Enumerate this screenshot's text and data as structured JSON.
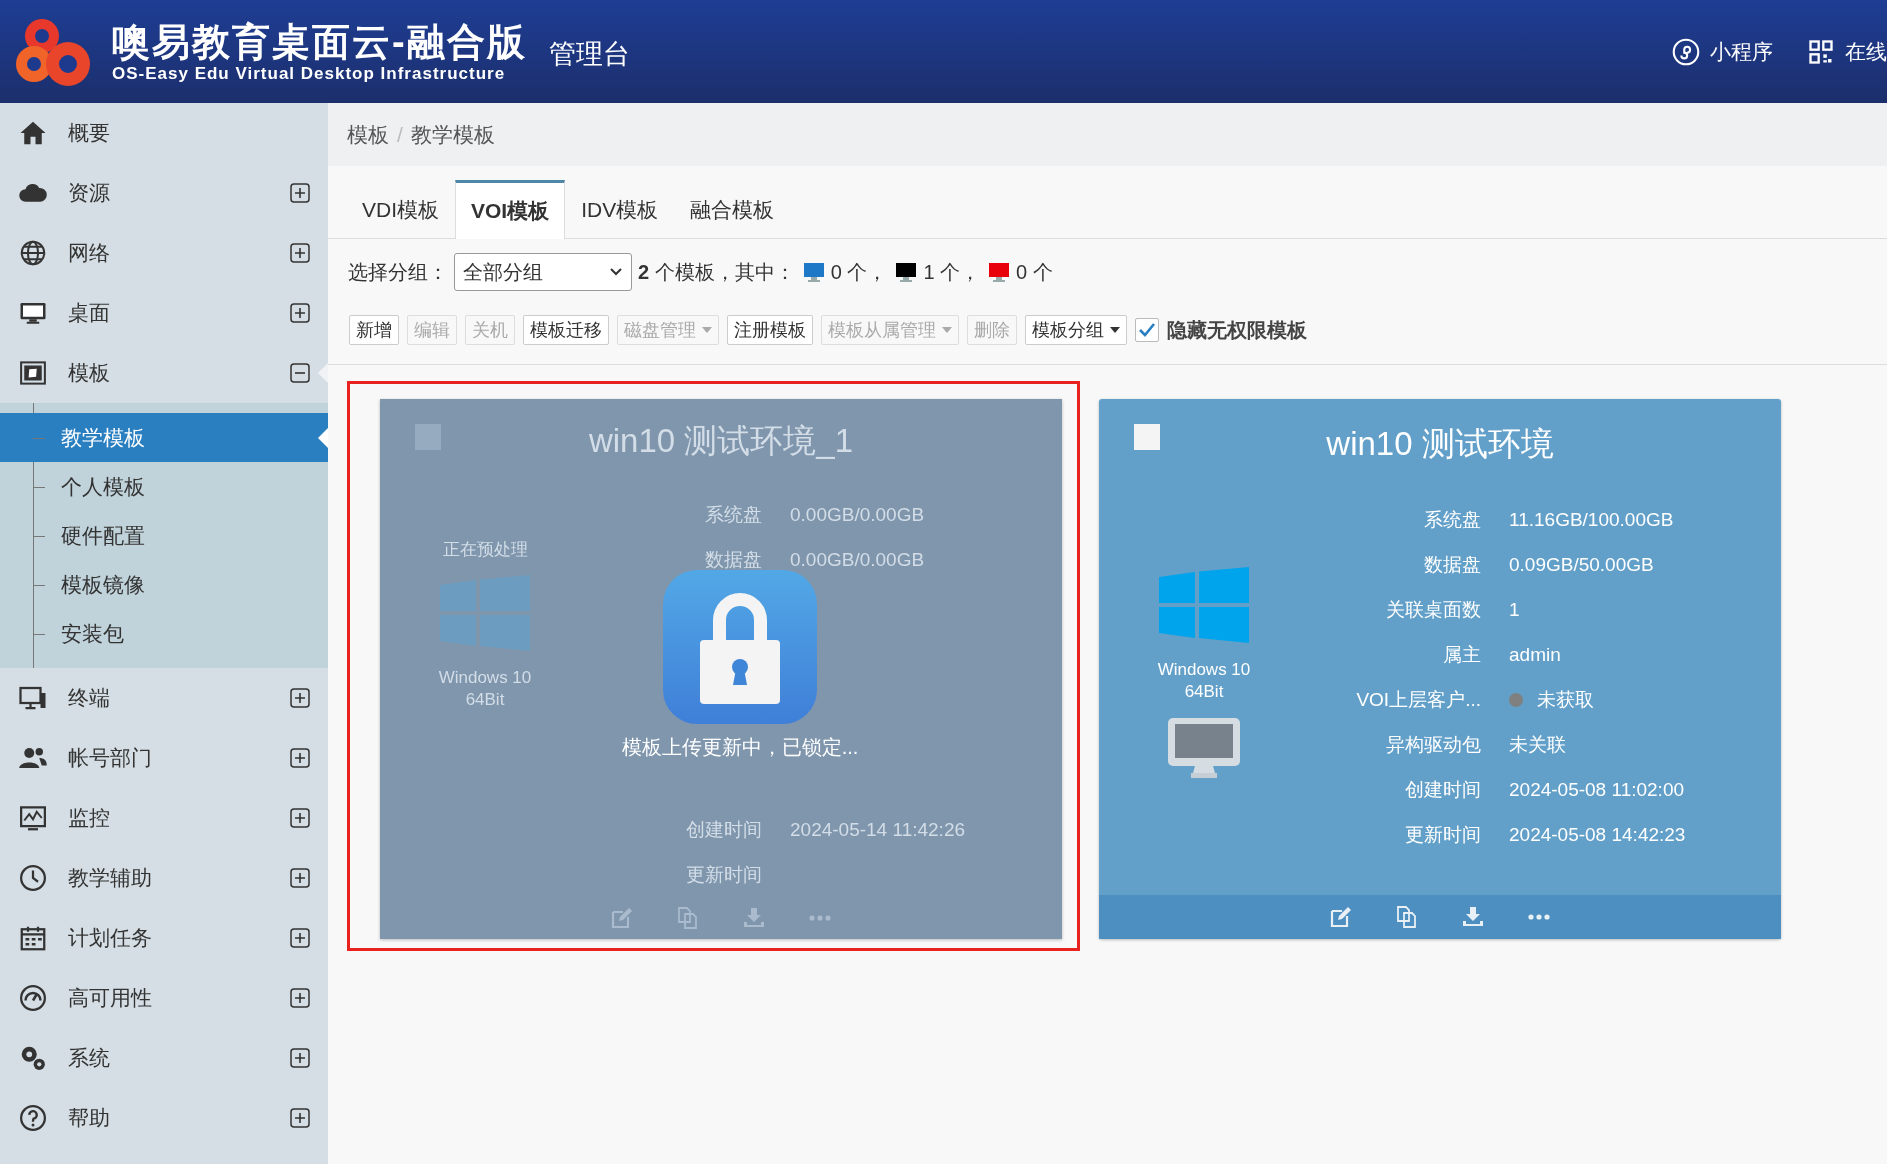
{
  "header": {
    "title": "噢易教育桌面云-融合版",
    "subtitle": "OS-Easy Edu Virtual Desktop Infrastructure",
    "console": "管理台",
    "links": [
      {
        "label": "小程序"
      },
      {
        "label": "在线"
      }
    ]
  },
  "sidebar": {
    "items": [
      {
        "label": "概要"
      },
      {
        "label": "资源",
        "expanded": false
      },
      {
        "label": "网络",
        "expanded": false
      },
      {
        "label": "桌面",
        "expanded": false
      },
      {
        "label": "模板",
        "expanded": true,
        "children": [
          {
            "label": "教学模板",
            "selected": true
          },
          {
            "label": "个人模板",
            "selected": false
          },
          {
            "label": "硬件配置",
            "selected": false
          },
          {
            "label": "模板镜像",
            "selected": false
          },
          {
            "label": "安装包",
            "selected": false
          }
        ]
      },
      {
        "label": "终端",
        "expanded": false
      },
      {
        "label": "帐号部门",
        "expanded": false
      },
      {
        "label": "监控",
        "expanded": false
      },
      {
        "label": "教学辅助",
        "expanded": false
      },
      {
        "label": "计划任务",
        "expanded": false
      },
      {
        "label": "高可用性",
        "expanded": false
      },
      {
        "label": "系统",
        "expanded": false
      },
      {
        "label": "帮助",
        "expanded": false
      }
    ]
  },
  "breadcrumb": {
    "items": [
      "模板",
      "教学模板"
    ],
    "separator": "/"
  },
  "tabs": [
    {
      "label": "VDI模板",
      "selected": false
    },
    {
      "label": "VOI模板",
      "selected": true
    },
    {
      "label": "IDV模板",
      "selected": false
    },
    {
      "label": "融合模板",
      "selected": false
    }
  ],
  "filter": {
    "label": "选择分组：",
    "group": "全部分组",
    "summary": "**2** 个模板，其中：",
    "legend": [
      {
        "color": "#1e78c8",
        "count": "0 个，"
      },
      {
        "color": "#000000",
        "count": "1 个，"
      },
      {
        "color": "#e8000b",
        "count": "0 个"
      }
    ]
  },
  "toolbar": {
    "buttons": [
      {
        "label": "新增",
        "disabled": false,
        "dropdown": false
      },
      {
        "label": "编辑",
        "disabled": true,
        "dropdown": false
      },
      {
        "label": "关机",
        "disabled": true,
        "dropdown": false
      },
      {
        "label": "模板迁移",
        "disabled": false,
        "dropdown": false
      },
      {
        "label": "磁盘管理",
        "disabled": true,
        "dropdown": true
      },
      {
        "label": "注册模板",
        "disabled": false,
        "dropdown": false
      },
      {
        "label": "模板从属管理",
        "disabled": true,
        "dropdown": true
      },
      {
        "label": "删除",
        "disabled": true,
        "dropdown": false
      },
      {
        "label": "模板分组",
        "disabled": false,
        "dropdown": true
      }
    ],
    "hide_unauthorized": {
      "label": "隐藏无权限模板",
      "checked": true
    }
  },
  "templates": [
    {
      "kind": "locked",
      "title": "win10 测试环境_1",
      "checked": false,
      "status": "正在预处理",
      "os": "Windows 10 64Bit",
      "rows_above": [
        {
          "label": "系统盘",
          "value": "0.00GB/0.00GB"
        },
        {
          "label": "数据盘",
          "value": "0.00GB/0.00GB"
        }
      ],
      "lock": {
        "message": "模板上传更新中，已锁定..."
      },
      "rows_below": [
        {
          "label": "创建时间",
          "value": "2024-05-14 11:42:26"
        },
        {
          "label": "更新时间"
        }
      ]
    },
    {
      "kind": "normal",
      "title": "win10 测试环境",
      "checked": false,
      "os": "Windows 10 64Bit",
      "rows": [
        {
          "label": "系统盘",
          "value": "11.16GB/100.00GB"
        },
        {
          "label": "数据盘",
          "value": "0.09GB/50.00GB"
        },
        {
          "label": "关联桌面数",
          "value": "1"
        },
        {
          "label": "属主",
          "value": "admin"
        },
        {
          "label": "VOI上层客户...",
          "kind": "status",
          "color": "#808080",
          "value": "未获取"
        },
        {
          "label": "异构驱动包",
          "value": "未关联"
        },
        {
          "label": "创建时间",
          "value": "2024-05-08 11:02:00"
        },
        {
          "label": "更新时间",
          "value": "2024-05-08 14:42:23"
        }
      ]
    }
  ]
}
